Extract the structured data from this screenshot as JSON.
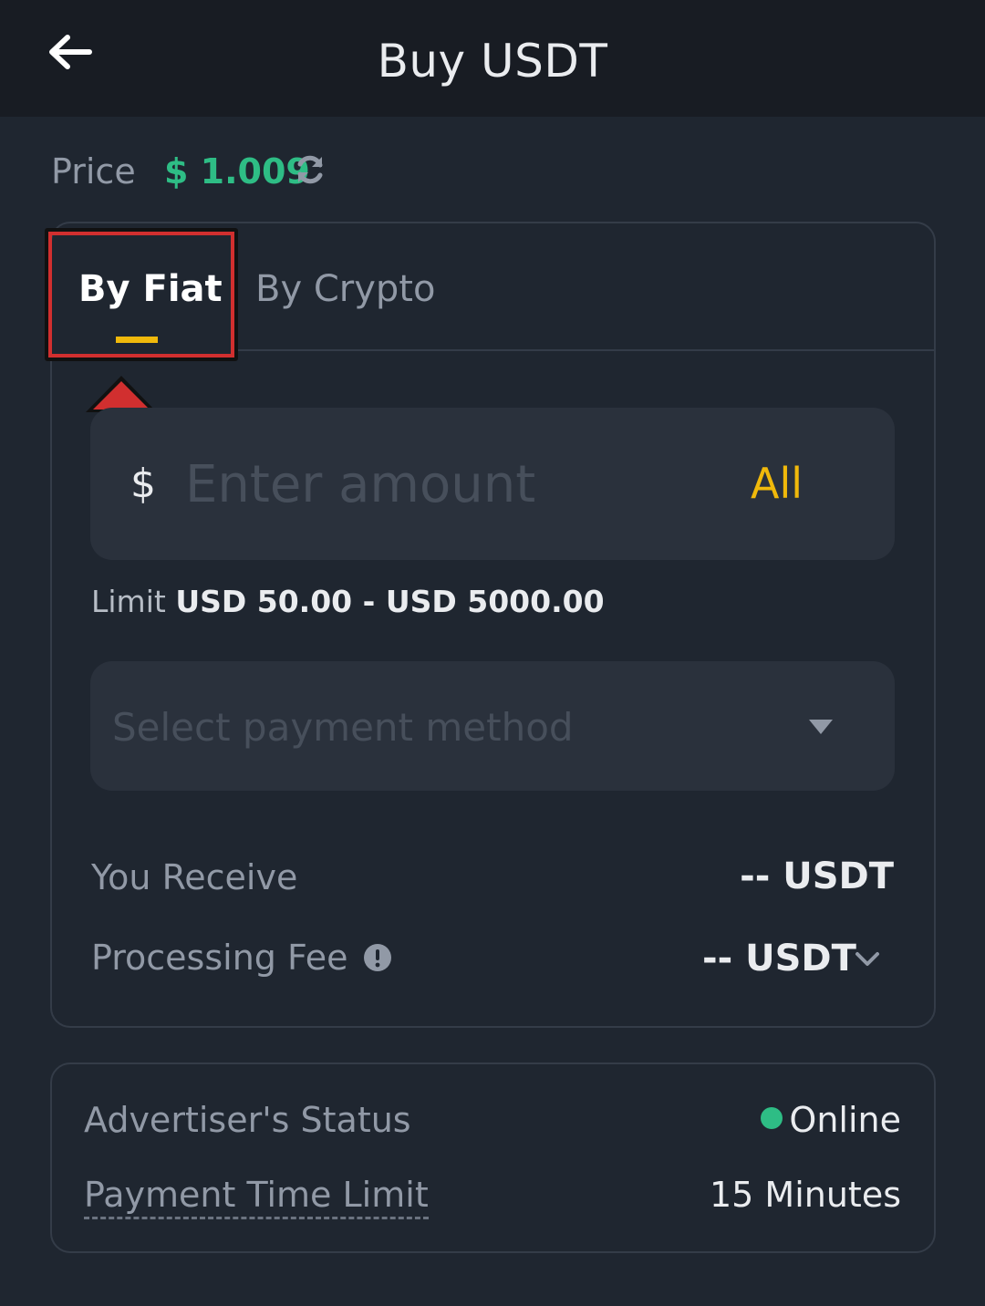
{
  "header": {
    "title": "Buy USDT",
    "back_icon": "arrow-left-icon"
  },
  "price": {
    "label": "Price",
    "value": "$ 1.009",
    "refresh_icon": "refresh-icon"
  },
  "tabs": [
    {
      "label": "By Fiat",
      "active": true
    },
    {
      "label": "By Crypto",
      "active": false
    }
  ],
  "amount": {
    "currency_symbol": "$",
    "placeholder": "Enter amount",
    "value": "",
    "all_label": "All"
  },
  "limit": {
    "label": "Limit",
    "value": "USD 50.00 - USD 5000.00"
  },
  "payment": {
    "placeholder": "Select payment method"
  },
  "summary": {
    "receive_label": "You Receive",
    "receive_value": "-- USDT",
    "fee_label": "Processing Fee",
    "fee_value": "-- USDT"
  },
  "advertiser": {
    "status_label": "Advertiser's Status",
    "status_value": "Online",
    "time_label": "Payment Time Limit",
    "time_value": "15 Minutes"
  },
  "colors": {
    "background": "#1f2630",
    "header": "#181c23",
    "accent": "#f0b90b",
    "price_green": "#2ebd85",
    "highlight": "#d12f2f"
  }
}
